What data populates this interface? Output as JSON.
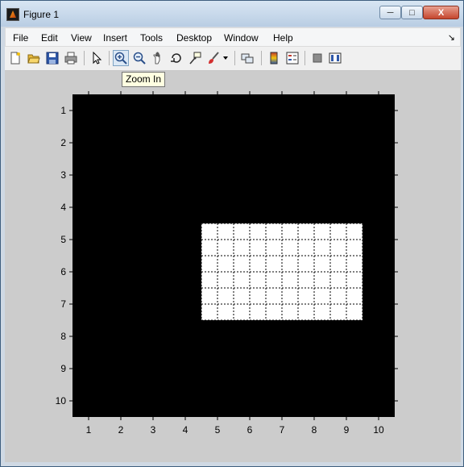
{
  "window": {
    "title": "Figure 1",
    "min_label": "─",
    "max_label": "□",
    "close_label": "X"
  },
  "menubar": {
    "items": [
      "File",
      "Edit",
      "View",
      "Insert",
      "Tools",
      "Desktop",
      "Window",
      "Help"
    ],
    "overflow_arrow": "↘"
  },
  "toolbar": {
    "icons": [
      "new-figure-icon",
      "open-file-icon",
      "save-icon",
      "print-icon",
      "edit-plot-arrow-icon",
      "zoom-in-icon",
      "zoom-out-icon",
      "pan-hand-icon",
      "rotate-3d-icon",
      "data-cursor-icon",
      "brush-icon",
      "brush-dropdown-icon",
      "link-plot-icon",
      "colorbar-icon",
      "legend-icon",
      "hide-plot-tools-icon",
      "show-plot-tools-icon"
    ],
    "active_tool": "zoom-in-icon"
  },
  "tooltip": {
    "text": "Zoom In"
  },
  "chart_data": {
    "type": "heatmap",
    "title": "",
    "xlabel": "",
    "ylabel": "",
    "x_ticks": [
      "1",
      "2",
      "3",
      "4",
      "5",
      "6",
      "7",
      "8",
      "9",
      "10"
    ],
    "y_ticks": [
      "1",
      "2",
      "3",
      "4",
      "5",
      "6",
      "7",
      "8",
      "9",
      "10"
    ],
    "xlim": [
      0.5,
      10.5
    ],
    "ylim": [
      0.5,
      10.5
    ],
    "y_direction": "reversed",
    "colors": {
      "zero": "#000000",
      "one": "#ffffff",
      "grid": "#000000"
    },
    "matrix": [
      [
        0,
        0,
        0,
        0,
        0,
        0,
        0,
        0,
        0,
        0
      ],
      [
        0,
        0,
        0,
        0,
        0,
        0,
        0,
        0,
        0,
        0
      ],
      [
        0,
        0,
        0,
        0,
        0,
        0,
        0,
        0,
        0,
        0
      ],
      [
        0,
        0,
        0,
        0,
        0,
        0,
        0,
        0,
        0,
        0
      ],
      [
        0,
        0,
        0,
        0,
        1,
        1,
        1,
        1,
        1,
        0
      ],
      [
        0,
        0,
        0,
        0,
        1,
        1,
        1,
        1,
        1,
        0
      ],
      [
        0,
        0,
        0,
        0,
        1,
        1,
        1,
        1,
        1,
        0
      ],
      [
        0,
        0,
        0,
        0,
        0,
        0,
        0,
        0,
        0,
        0
      ],
      [
        0,
        0,
        0,
        0,
        0,
        0,
        0,
        0,
        0,
        0
      ],
      [
        0,
        0,
        0,
        0,
        0,
        0,
        0,
        0,
        0,
        0
      ]
    ],
    "grid": "dotted, half-step spacing"
  }
}
